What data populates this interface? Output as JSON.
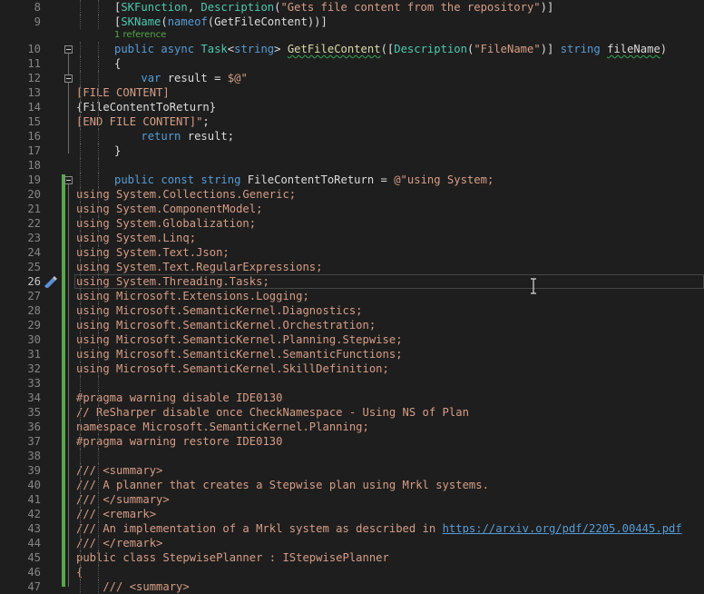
{
  "colors": {
    "default": "#dcdcdc",
    "keyword": "#569cd6",
    "type": "#4ec9b0",
    "method": "#dcdcaa",
    "string": "#d69d85",
    "comment": "#57a64a",
    "doc_tag": "#808080",
    "link": "#569cd6",
    "line_number": "#858585"
  },
  "icons": {
    "quick_action": "pencil-lightbulb-icon",
    "cursor": "text-ibeam-cursor-icon"
  },
  "editor": {
    "current_line": 26,
    "code_lens_label": "1 reference",
    "lines": [
      {
        "n": "8",
        "segs": [
          [
            "[",
            "d"
          ],
          [
            "SKFunction",
            "t"
          ],
          [
            ", ",
            "d"
          ],
          [
            "Description",
            "t"
          ],
          [
            "(",
            "d"
          ],
          [
            "\"Gets file content from the repository\"",
            "s"
          ],
          [
            ")]",
            "d"
          ]
        ]
      },
      {
        "n": "9",
        "segs": [
          [
            "[",
            "d"
          ],
          [
            "SKName",
            "t"
          ],
          [
            "(",
            "d"
          ],
          [
            "nameof",
            "k"
          ],
          [
            "(",
            "d"
          ],
          [
            "GetFileContent",
            "d"
          ],
          [
            "))]",
            "d"
          ]
        ]
      },
      {
        "n": "",
        "lens": true,
        "segs": [
          [
            "1 reference",
            "c"
          ]
        ]
      },
      {
        "n": "10",
        "segs": [
          [
            "public ",
            "k"
          ],
          [
            "async ",
            "k"
          ],
          [
            "Task",
            "t"
          ],
          [
            "<",
            "d"
          ],
          [
            "string",
            "k"
          ],
          [
            "> ",
            "d"
          ],
          [
            "GetFileContent",
            "m",
            "squiggle"
          ],
          [
            "([",
            "d"
          ],
          [
            "Description",
            "t"
          ],
          [
            "(",
            "d"
          ],
          [
            "\"FileName\"",
            "s"
          ],
          [
            ")] ",
            "d"
          ],
          [
            "string ",
            "k"
          ],
          [
            "fileName",
            "d",
            "squiggle"
          ],
          [
            ")",
            "d"
          ]
        ]
      },
      {
        "n": "11",
        "segs": [
          [
            "{",
            "d"
          ]
        ]
      },
      {
        "n": "12",
        "segs": [
          [
            "    ",
            "d"
          ],
          [
            "var ",
            "k"
          ],
          [
            "result = ",
            "d"
          ],
          [
            "$@\"",
            "s"
          ]
        ]
      },
      {
        "n": "13",
        "segs": [
          [
            "[FILE CONTENT]",
            "s"
          ]
        ]
      },
      {
        "n": "14",
        "segs": [
          [
            "{",
            "d"
          ],
          [
            "FileContentToReturn",
            "d"
          ],
          [
            "}",
            "d"
          ]
        ]
      },
      {
        "n": "15",
        "segs": [
          [
            "[END FILE CONTENT]\"",
            "s"
          ],
          [
            ";",
            "d"
          ]
        ]
      },
      {
        "n": "16",
        "segs": [
          [
            "    ",
            "d"
          ],
          [
            "return ",
            "k"
          ],
          [
            "result;",
            "d"
          ]
        ]
      },
      {
        "n": "17",
        "segs": [
          [
            "}",
            "d"
          ]
        ]
      },
      {
        "n": "18",
        "segs": []
      },
      {
        "n": "19",
        "segs": [
          [
            "public ",
            "k"
          ],
          [
            "const ",
            "k"
          ],
          [
            "string ",
            "k"
          ],
          [
            "FileContentToReturn = ",
            "d"
          ],
          [
            "@\"using System;",
            "s"
          ]
        ]
      },
      {
        "n": "20",
        "segs": [
          [
            "using System.Collections.Generic;",
            "s"
          ]
        ]
      },
      {
        "n": "21",
        "segs": [
          [
            "using System.ComponentModel;",
            "s"
          ]
        ]
      },
      {
        "n": "22",
        "segs": [
          [
            "using System.Globalization;",
            "s"
          ]
        ]
      },
      {
        "n": "23",
        "segs": [
          [
            "using System.Linq;",
            "s"
          ]
        ]
      },
      {
        "n": "24",
        "segs": [
          [
            "using System.Text.Json;",
            "s"
          ]
        ]
      },
      {
        "n": "25",
        "segs": [
          [
            "using System.Text.RegularExpressions;",
            "s"
          ]
        ]
      },
      {
        "n": "26",
        "segs": [
          [
            "using System.Threading.Tasks;",
            "s"
          ]
        ]
      },
      {
        "n": "27",
        "segs": [
          [
            "using Microsoft.Extensions.Logging;",
            "s"
          ]
        ]
      },
      {
        "n": "28",
        "segs": [
          [
            "using Microsoft.SemanticKernel.Diagnostics;",
            "s"
          ]
        ]
      },
      {
        "n": "29",
        "segs": [
          [
            "using Microsoft.SemanticKernel.Orchestration;",
            "s"
          ]
        ]
      },
      {
        "n": "30",
        "segs": [
          [
            "using Microsoft.SemanticKernel.Planning.Stepwise;",
            "s"
          ]
        ]
      },
      {
        "n": "31",
        "segs": [
          [
            "using Microsoft.SemanticKernel.SemanticFunctions;",
            "s"
          ]
        ]
      },
      {
        "n": "32",
        "segs": [
          [
            "using Microsoft.SemanticKernel.SkillDefinition;",
            "s"
          ]
        ]
      },
      {
        "n": "33",
        "segs": []
      },
      {
        "n": "34",
        "segs": [
          [
            "#pragma warning disable IDE0130",
            "s"
          ]
        ]
      },
      {
        "n": "35",
        "segs": [
          [
            "// ReSharper disable once CheckNamespace - Using NS of Plan",
            "s"
          ]
        ]
      },
      {
        "n": "36",
        "segs": [
          [
            "namespace Microsoft.SemanticKernel.Planning;",
            "s"
          ]
        ]
      },
      {
        "n": "37",
        "segs": [
          [
            "#pragma warning restore IDE0130",
            "s"
          ]
        ]
      },
      {
        "n": "38",
        "segs": []
      },
      {
        "n": "39",
        "segs": [
          [
            "/// <summary>",
            "s"
          ]
        ]
      },
      {
        "n": "40",
        "segs": [
          [
            "/// A planner that creates a Stepwise plan using Mrkl systems.",
            "s"
          ]
        ]
      },
      {
        "n": "41",
        "segs": [
          [
            "/// </summary>",
            "s"
          ]
        ]
      },
      {
        "n": "42",
        "segs": [
          [
            "/// <remark>",
            "s"
          ]
        ]
      },
      {
        "n": "43",
        "segs": [
          [
            "/// An implementation of a Mrkl system as described in ",
            "s"
          ],
          [
            "https://arxiv.org/pdf/2205.00445.pdf",
            "l",
            "link"
          ]
        ]
      },
      {
        "n": "44",
        "segs": [
          [
            "/// </remark>",
            "s"
          ]
        ]
      },
      {
        "n": "45",
        "segs": [
          [
            "public class StepwisePlanner : IStepwisePlanner",
            "s"
          ]
        ]
      },
      {
        "n": "46",
        "segs": [
          [
            "{",
            "s"
          ]
        ]
      },
      {
        "n": "47",
        "segs": [
          [
            "    /// <summary>",
            "s"
          ]
        ]
      }
    ]
  }
}
